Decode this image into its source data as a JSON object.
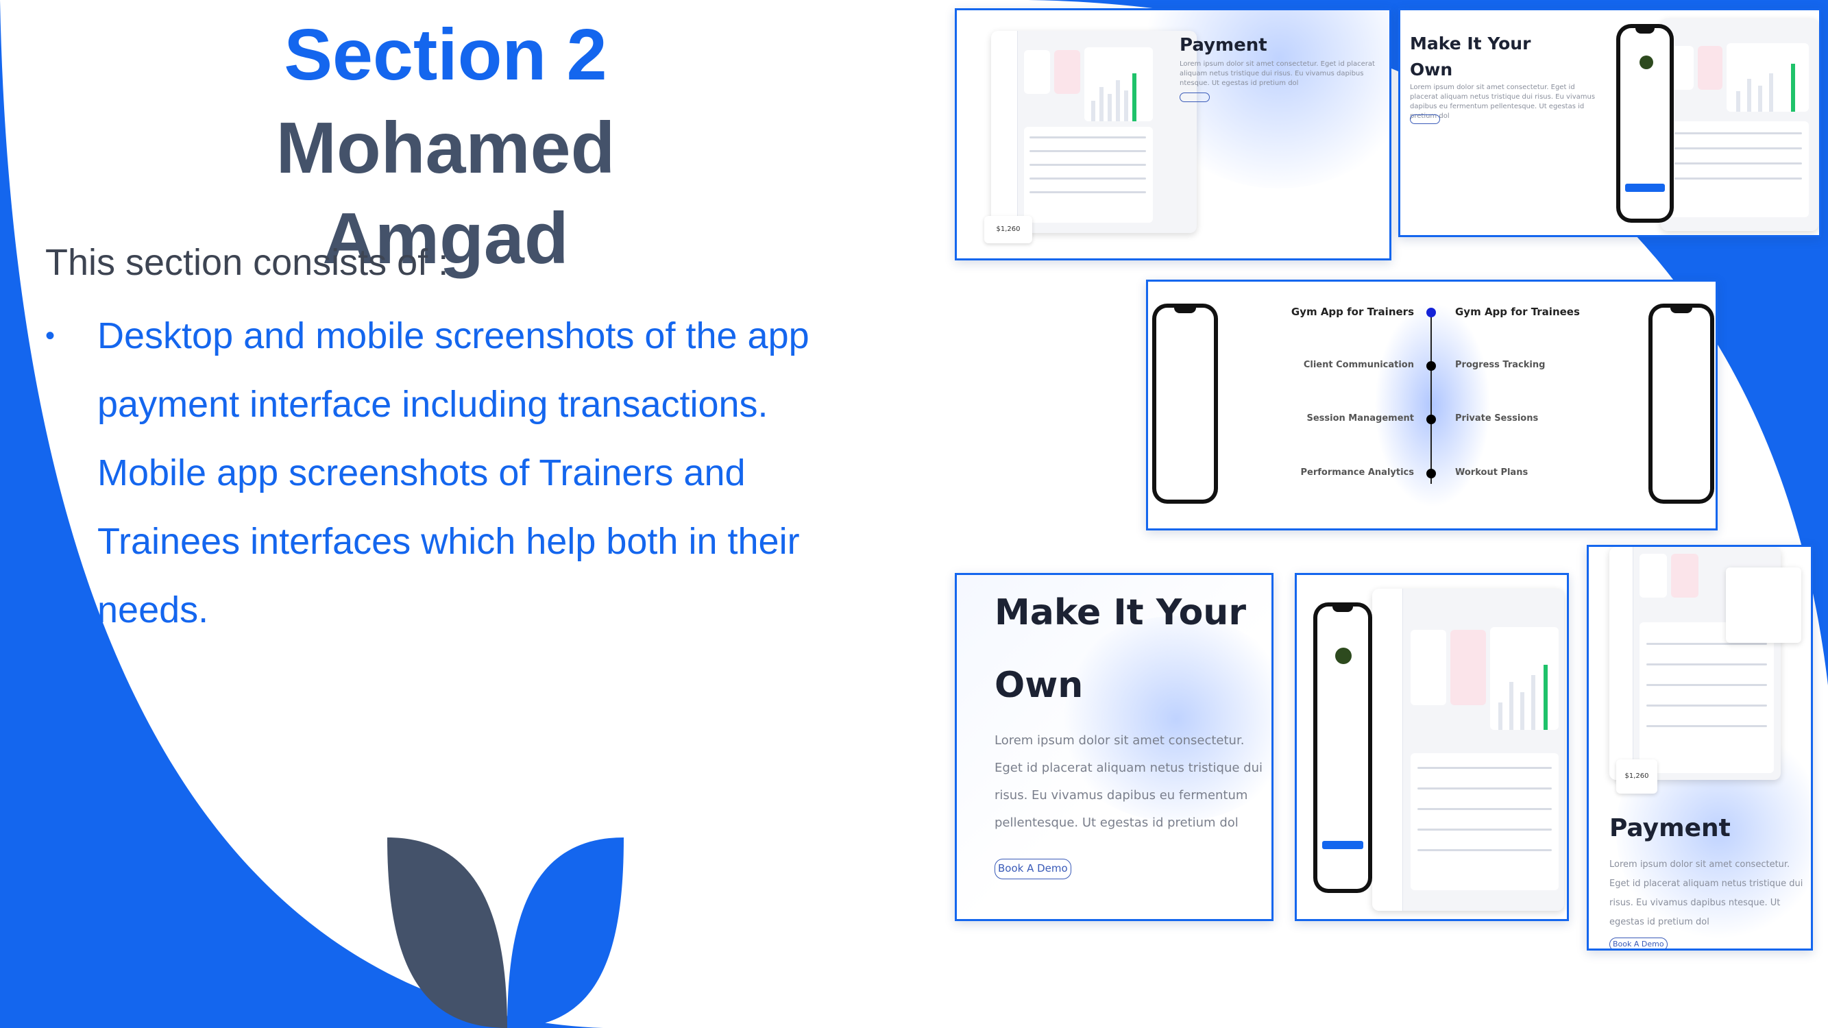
{
  "slide": {
    "title": "Section 2",
    "author": "Mohamed Amgad",
    "intro": "This section consists of :",
    "bullets": [
      "Desktop and mobile screenshots of the app payment interface including transactions.",
      "Mobile app screenshots of Trainers and Trainees interfaces which help both in their needs."
    ],
    "bullet_symbol": "•"
  },
  "colors": {
    "accent": "#1466ee",
    "dark": "#44526a",
    "text": "#3d4452"
  },
  "cards": {
    "payment_top": {
      "title": "Payment",
      "text": "Lorem ipsum dolor sit amet consectetur. Eget id placerat aliquam netus tristique dui risus. Eu vivamus dapibus ntesque. Ut egestas id pretium dol",
      "badge_amount": "$1,260"
    },
    "make_own_top": {
      "title": "Make It Your Own",
      "text": "Lorem ipsum dolor sit amet consectetur. Eget id placerat aliquam netus tristique dui risus. Eu vivamus dapibus eu fermentum pellentesque. Ut egestas id pretium dol"
    },
    "features": {
      "left_heading": "Gym App for Trainers",
      "right_heading": "Gym App for Trainees",
      "left_items": [
        "Client Communication",
        "Session Management",
        "Performance Analytics"
      ],
      "right_items": [
        "Progress Tracking",
        "Private Sessions",
        "Workout Plans"
      ]
    },
    "make_own_bottom": {
      "title_line1": "Make It Your",
      "title_line2": "Own",
      "text": "Lorem ipsum dolor sit amet consectetur. Eget id placerat aliquam netus tristique dui risus. Eu vivamus dapibus eu fermentum pellentesque. Ut egestas id pretium dol",
      "button": "Book A Demo"
    },
    "payment_bottom": {
      "title": "Payment",
      "text": "Lorem ipsum dolor sit amet consectetur. Eget id placerat aliquam netus tristique dui risus. Eu vivamus dapibus ntesque. Ut egestas id pretium dol",
      "button": "Book A Demo",
      "badge_amount": "$1,260"
    }
  }
}
